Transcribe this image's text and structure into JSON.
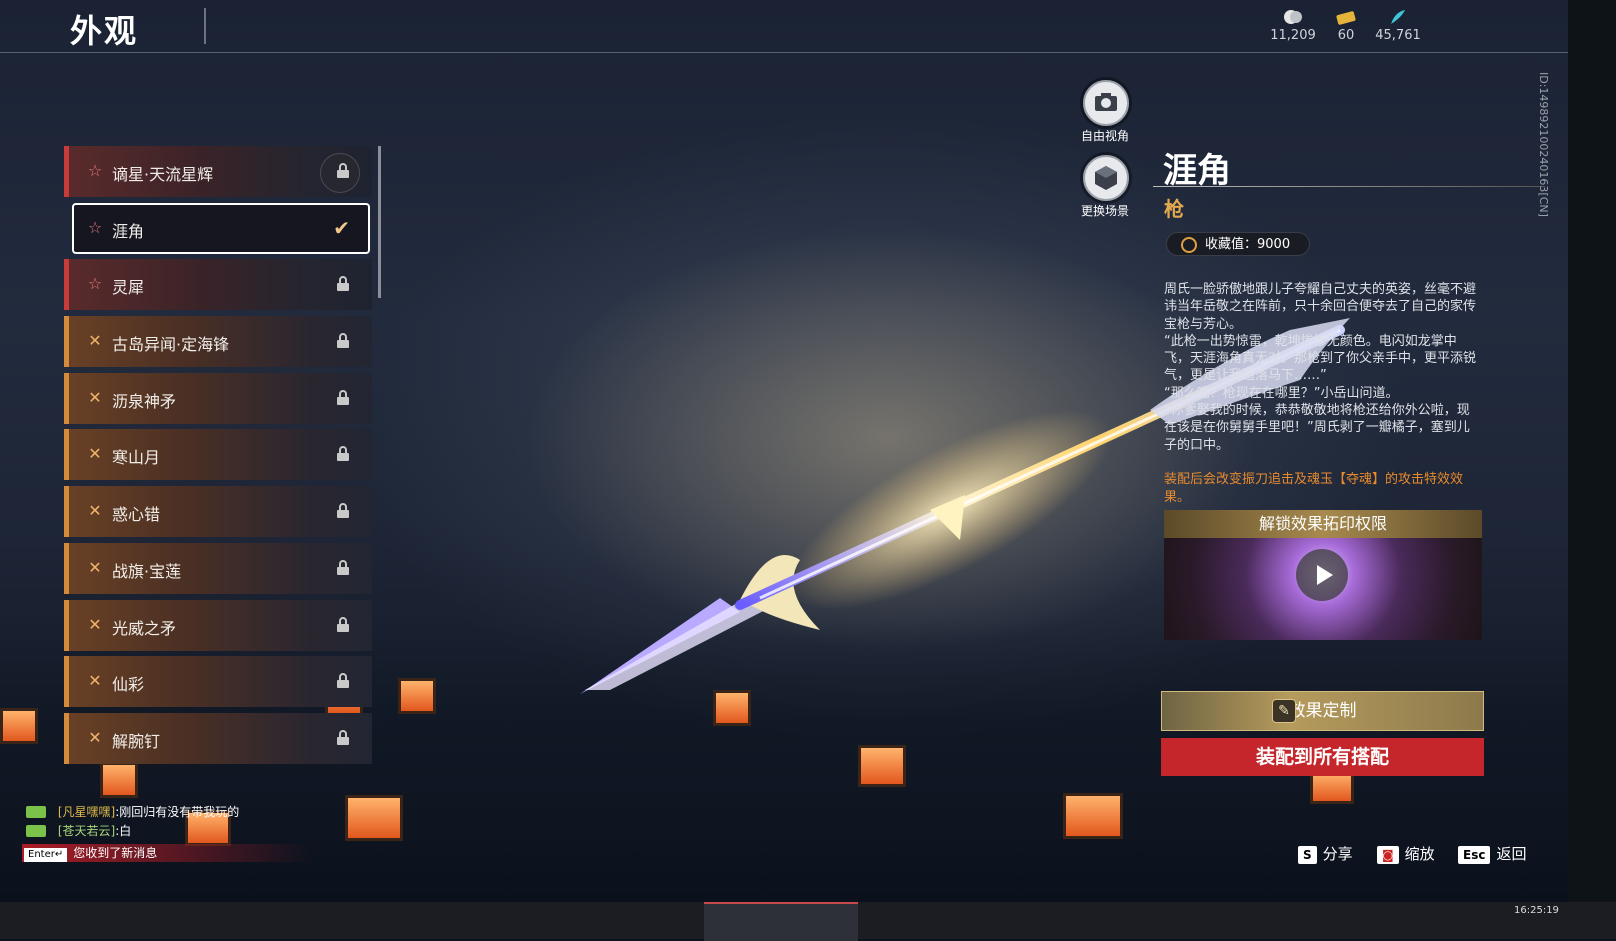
{
  "header": {
    "title": "外观"
  },
  "currencies": [
    {
      "icon": "coin-icon",
      "value": "11,209"
    },
    {
      "icon": "ticket-icon",
      "value": "60"
    },
    {
      "icon": "feather-icon",
      "value": "45,761"
    }
  ],
  "list": {
    "items": [
      {
        "label": "谪星·天流星辉",
        "rarity": "red",
        "state": "locked"
      },
      {
        "label": "涯角",
        "rarity": "red",
        "state": "selected"
      },
      {
        "label": "灵犀",
        "rarity": "red",
        "state": "locked"
      },
      {
        "label": "古岛异闻·定海锋",
        "rarity": "gold",
        "state": "locked"
      },
      {
        "label": "沥泉神矛",
        "rarity": "gold",
        "state": "locked"
      },
      {
        "label": "寒山月",
        "rarity": "gold",
        "state": "locked"
      },
      {
        "label": "惑心错",
        "rarity": "gold",
        "state": "locked"
      },
      {
        "label": "战旗·宝莲",
        "rarity": "gold",
        "state": "locked"
      },
      {
        "label": "光威之矛",
        "rarity": "gold",
        "state": "locked"
      },
      {
        "label": "仙彩",
        "rarity": "gold",
        "state": "locked"
      },
      {
        "label": "解腕钉",
        "rarity": "gold",
        "state": "locked"
      }
    ]
  },
  "camera": {
    "free_view": "自由视角",
    "change_scene": "更换场景"
  },
  "detail": {
    "name": "涯角",
    "type": "枪",
    "collection": "收藏值：9000",
    "description": "周氏一脸骄傲地跟儿子夸耀自己丈夫的英姿，丝毫不避讳当年岳敬之在阵前，只十余回合便夺去了自己的家传宝枪与芳心。\n“此枪一出势惊雷，乾坤惨惨无颜色。电闪如龙掌中飞，天涯海角真无对。那枪到了你父亲手中，更平添锐气，更是让我遁落马下……”\n“那么呢？枪现在在哪里？”小岳山问道。\n“你爹娶我的时候，恭恭敬敬地将枪还给你外公啦，现在该是在你舅舅手里吧！”周氏剥了一瓣橘子，塞到儿子的口中。",
    "effect": "装配后会改变振刀追击及魂玉【夺魂】的攻击特效效果。",
    "video_header": "解锁效果拓印权限",
    "customize_button": "效果定制",
    "equip_button": "装配到所有搭配"
  },
  "chat": [
    {
      "name": "[凡星嘿嘿]",
      "text": ":刚回归有没有带我玩的"
    },
    {
      "name": "[苍天若云]",
      "text": ":白"
    }
  ],
  "notice": {
    "key": "Enter↵",
    "text": "您收到了新消息"
  },
  "hints": [
    {
      "key": "S",
      "label": "分享"
    },
    {
      "key": "",
      "label": "缩放"
    },
    {
      "key": "Esc",
      "label": "返回"
    }
  ],
  "side_id": "ID:1498921002401​63[CN]",
  "clock": "16:25:19",
  "colors": {
    "red_bar": "#c73b3b",
    "gold_bar": "#d48b3c",
    "equip": "#c4262b",
    "type_text": "#e2a94f",
    "effect_text": "#e88a2e"
  }
}
